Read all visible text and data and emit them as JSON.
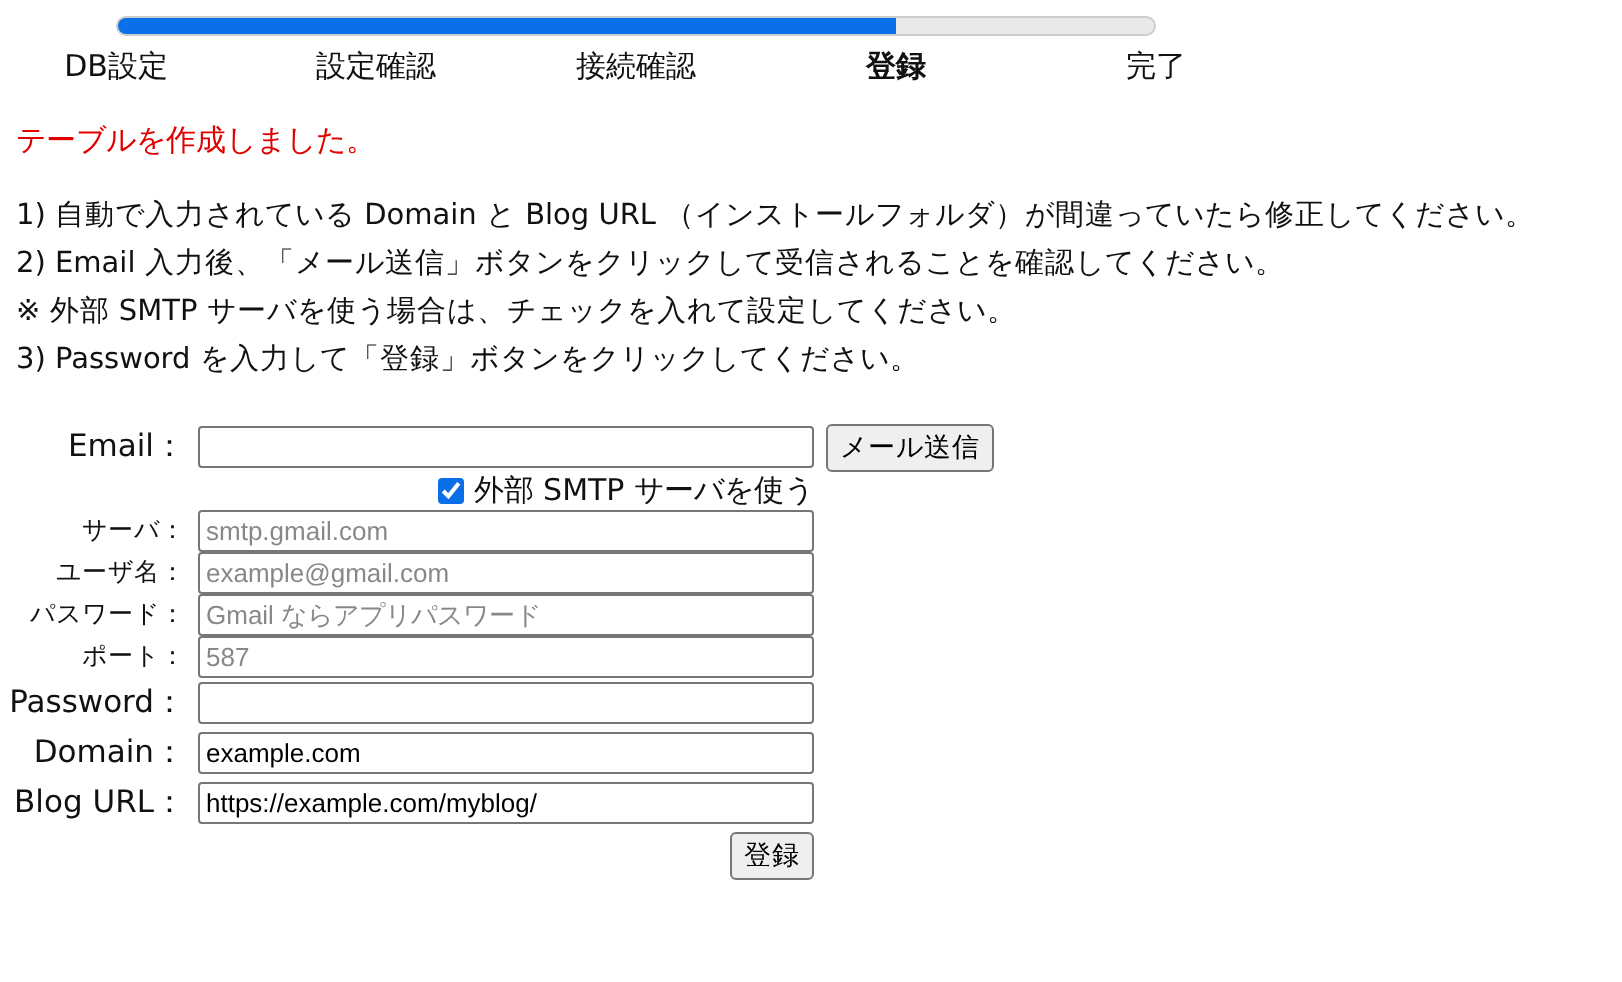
{
  "progress": {
    "level": 0.75
  },
  "steps": [
    {
      "label": "DB設定",
      "selected": false
    },
    {
      "label": "設定確認",
      "selected": false
    },
    {
      "label": "接続確認",
      "selected": false
    },
    {
      "label": "登録",
      "selected": true
    },
    {
      "label": "完了",
      "selected": false
    }
  ],
  "message": "テーブルを作成しました。",
  "instructions": [
    "1) 自動で入力されている Domain と Blog URL （インストールフォルダ）が間違っていたら修正してください。",
    "2) Email 入力後、「メール送信」ボタンをクリックして受信されることを確認してください。",
    "※ 外部 SMTP サーバを使う場合は、チェックを入れて設定してください。",
    "3) Password を入力して「登録」ボタンをクリックしてください。"
  ],
  "form": [
    {
      "kind": "field",
      "label": "Email：",
      "button": "メール送信"
    },
    {
      "kind": "checkbox",
      "label": "外部 SMTP サーバを使う",
      "checked": true
    },
    {
      "kind": "smtp",
      "label": "サーバ：",
      "placeholder": "smtp.gmail.com"
    },
    {
      "kind": "smtp",
      "label": "ユーザ名：",
      "placeholder": "example@gmail.com"
    },
    {
      "kind": "smtp",
      "label": "パスワード：",
      "placeholder": "Gmail ならアプリパスワード"
    },
    {
      "kind": "smtp",
      "label": "ポート：",
      "placeholder": "587"
    },
    {
      "kind": "field",
      "label": "Password："
    },
    {
      "kind": "field",
      "label": "Domain：",
      "value": "example.com"
    },
    {
      "kind": "field",
      "label": "Blog URL：",
      "value": "https://example.com/myblog/"
    },
    {
      "kind": "submit",
      "button": "登録"
    }
  ]
}
